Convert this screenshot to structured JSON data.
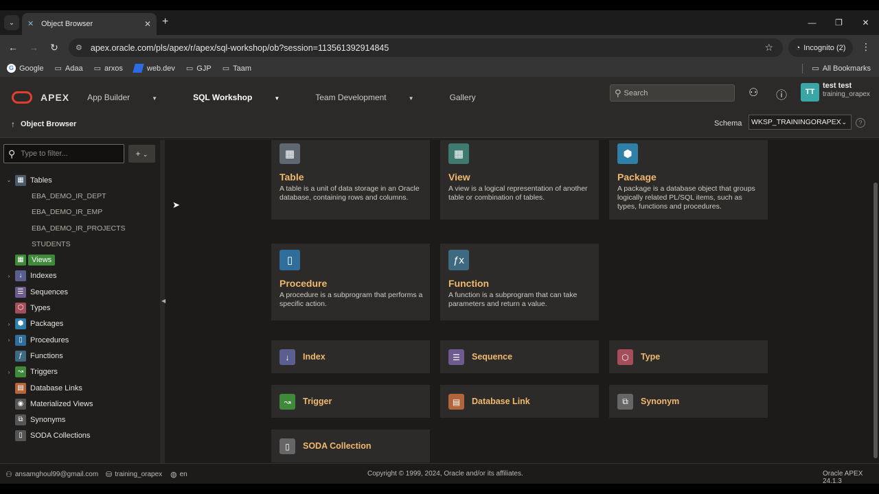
{
  "browser": {
    "tab_title": "Object Browser",
    "url": "apex.oracle.com/pls/apex/r/apex/sql-workshop/ob?session=113561392914845",
    "incognito": "Incognito (2)",
    "bookmarks": [
      "Google",
      "Adaa",
      "arxos",
      "web.dev",
      "GJP",
      "Taam"
    ],
    "all_bookmarks": "All Bookmarks"
  },
  "apex": {
    "brand": "APEX",
    "menu": [
      "App Builder",
      "SQL Workshop",
      "Team Development",
      "Gallery"
    ],
    "search_placeholder": "Search",
    "avatar": "TT",
    "user_name": "test test",
    "user_schema": "training_orapex"
  },
  "crumb": {
    "title": "Object Browser",
    "schema_label": "Schema",
    "schema_value": "WKSP_TRAININGORAPEX"
  },
  "sidebar": {
    "filter_placeholder": "Type to filter...",
    "add_label": "+",
    "tree": [
      {
        "label": "Tables",
        "icon": "table-icon",
        "color": "#4b5a6a",
        "glyph": "▦",
        "toggle": "⌄"
      },
      {
        "label": "EBA_DEMO_IR_DEPT",
        "child": true
      },
      {
        "label": "EBA_DEMO_IR_EMP",
        "child": true
      },
      {
        "label": "EBA_DEMO_IR_PROJECTS",
        "child": true
      },
      {
        "label": "STUDENTS",
        "child": true
      },
      {
        "label": "Views",
        "icon": "view-icon",
        "color": "#3f8a3a",
        "glyph": "▦",
        "toggle": "",
        "selected": true
      },
      {
        "label": "Indexes",
        "icon": "index-icon",
        "color": "#5a5f8f",
        "glyph": "↓",
        "toggle": "›"
      },
      {
        "label": "Sequences",
        "icon": "sequence-icon",
        "color": "#6d5a8f",
        "glyph": "☰",
        "toggle": ""
      },
      {
        "label": "Types",
        "icon": "type-icon",
        "color": "#a64d5a",
        "glyph": "⬡",
        "toggle": ""
      },
      {
        "label": "Packages",
        "icon": "package-icon",
        "color": "#2f7fa8",
        "glyph": "⬢",
        "toggle": "›"
      },
      {
        "label": "Procedures",
        "icon": "procedure-icon",
        "color": "#2f6e9a",
        "glyph": "▯",
        "toggle": "›"
      },
      {
        "label": "Functions",
        "icon": "function-icon",
        "color": "#3d6a80",
        "glyph": "ƒ",
        "toggle": ""
      },
      {
        "label": "Triggers",
        "icon": "trigger-icon",
        "color": "#3f8a3a",
        "glyph": "↝",
        "toggle": "›"
      },
      {
        "label": "Database Links",
        "icon": "dblink-icon",
        "color": "#b2643a",
        "glyph": "▤",
        "toggle": ""
      },
      {
        "label": "Materialized Views",
        "icon": "matview-icon",
        "color": "#555",
        "glyph": "◉",
        "toggle": ""
      },
      {
        "label": "Synonyms",
        "icon": "synonym-icon",
        "color": "#555",
        "glyph": "⧉",
        "toggle": ""
      },
      {
        "label": "SODA Collections",
        "icon": "soda-icon",
        "color": "#555",
        "glyph": "▯",
        "toggle": ""
      }
    ]
  },
  "cards": [
    {
      "title": "Table",
      "desc": "A table is a unit of data storage in an Oracle database, containing rows and columns.",
      "icon": "table-icon",
      "color": "#5f6770",
      "glyph": "▦"
    },
    {
      "title": "View",
      "desc": "A view is a logical representation of another table or combination of tables.",
      "icon": "view-icon",
      "color": "#3f7a70",
      "glyph": "▦"
    },
    {
      "title": "Package",
      "desc": "A package is a database object that groups logically related PL/SQL items, such as types, functions and procedures.",
      "icon": "package-icon",
      "color": "#2f7fa8",
      "glyph": "⬢"
    },
    {
      "title": "Procedure",
      "desc": "A procedure is a subprogram that performs a specific action.",
      "icon": "procedure-icon",
      "color": "#2f6e9a",
      "glyph": "▯"
    },
    {
      "title": "Function",
      "desc": "A function is a subprogram that can take parameters and return a value.",
      "icon": "function-icon",
      "color": "#3d6a80",
      "glyph": "ƒx"
    }
  ],
  "small_cards": [
    {
      "title": "Index",
      "icon": "index-icon",
      "color": "#5a5f8f",
      "glyph": "↓"
    },
    {
      "title": "Sequence",
      "icon": "sequence-icon",
      "color": "#6d5a8f",
      "glyph": "☰"
    },
    {
      "title": "Type",
      "icon": "type-icon",
      "color": "#a64d5a",
      "glyph": "⬡"
    },
    {
      "title": "Trigger",
      "icon": "trigger-icon",
      "color": "#3f8a3a",
      "glyph": "↝"
    },
    {
      "title": "Database Link",
      "icon": "dblink-icon",
      "color": "#b2643a",
      "glyph": "▤"
    },
    {
      "title": "Synonym",
      "icon": "synonym-icon",
      "color": "#666",
      "glyph": "⧉"
    },
    {
      "title": "SODA Collection",
      "icon": "soda-icon",
      "color": "#666",
      "glyph": "▯"
    }
  ],
  "footer": {
    "email": "ansamghoul99@gmail.com",
    "workspace": "training_orapex",
    "lang": "en",
    "copyright": "Copyright © 1999, 2024, Oracle and/or its affiliates.",
    "version": "Oracle APEX 24.1.3"
  }
}
